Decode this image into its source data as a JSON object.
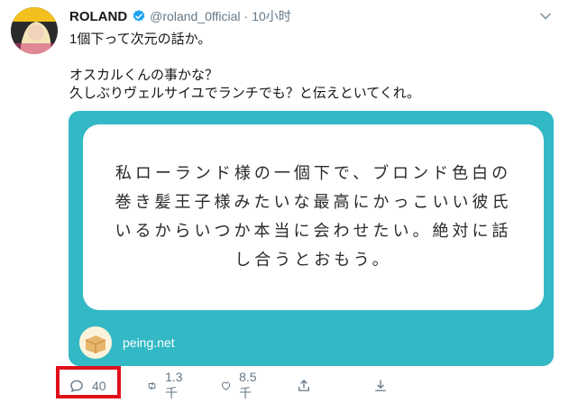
{
  "tweet": {
    "author_name": "ROLAND",
    "handle": "@roland_0fficial",
    "separator": "·",
    "time": "10小时",
    "text": "1個下って次元の話か。\n\nオスカルくんの事かな？\n久しぶりヴェルサイユでランチでも？と伝えといてくれ。"
  },
  "card": {
    "question": "私ローランド様の一個下で、ブロンド色白の巻き髪王子様みたいな最高にかっこいい彼氏いるからいつか本当に会わせたい。絶対に話し合うとおもう。",
    "site": "peing.net",
    "bg_color": "#32b9c5"
  },
  "actions": {
    "reply_count": "40",
    "retweet_count": "1.3千",
    "like_count": "8.5千"
  },
  "icons": [
    "verified-icon",
    "chevron-down-icon",
    "reply-icon",
    "retweet-icon",
    "like-icon",
    "share-icon",
    "download-icon"
  ],
  "highlight_color": "#e0101a"
}
